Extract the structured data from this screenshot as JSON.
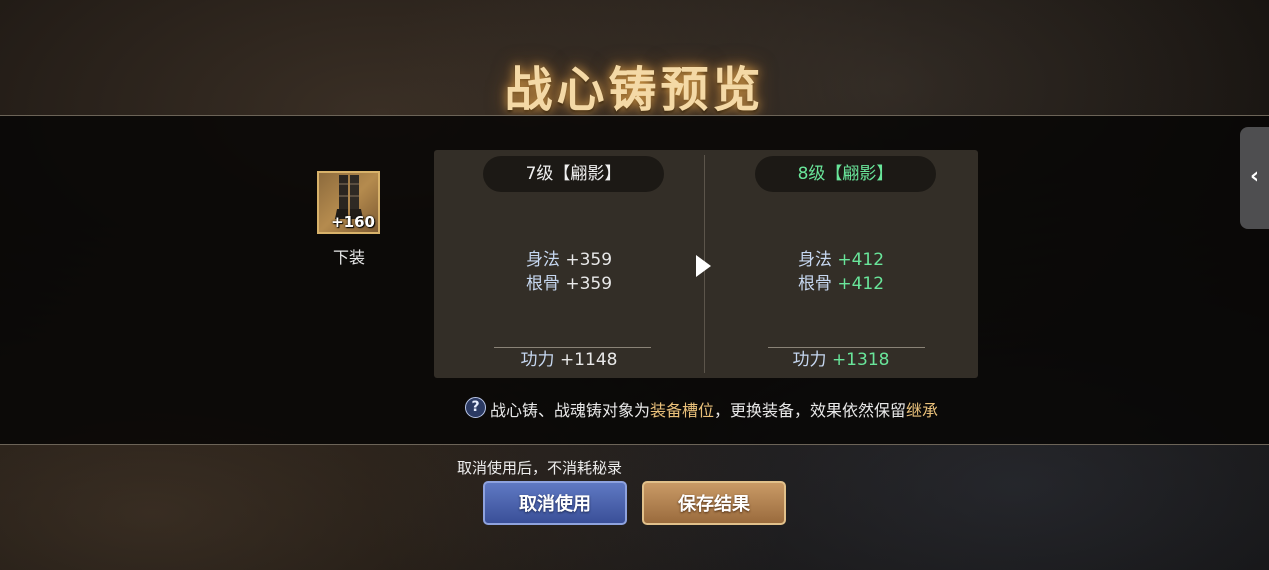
{
  "title": "战心铸预览",
  "item": {
    "level_badge": "+160",
    "name": "下装",
    "icon": "boots-icon"
  },
  "current": {
    "level_label": "7级【翩影】",
    "stats": [
      {
        "label": "身法",
        "value": "+359"
      },
      {
        "label": "根骨",
        "value": "+359"
      }
    ],
    "power_label": "功力",
    "power_value": "+1148"
  },
  "next": {
    "level_label": "8级【翩影】",
    "stats": [
      {
        "label": "身法",
        "value": "+412"
      },
      {
        "label": "根骨",
        "value": "+412"
      }
    ],
    "power_label": "功力",
    "power_value": "+1318"
  },
  "help": {
    "icon_text": "?",
    "part1": "战心铸、战魂铸对象为",
    "highlight1": "装备槽位",
    "part2": "，更换装备，效果依然保留",
    "highlight2": "继承"
  },
  "note": "取消使用后，不消耗秘录",
  "buttons": {
    "cancel_label": "取消使用",
    "save_label": "保存结果"
  },
  "side_tab": {
    "icon": "chevron-left-icon",
    "glyph": "‹"
  },
  "colors": {
    "title_glow": "#f4d9a6",
    "upgrade_green": "#69e59a",
    "highlight_gold": "#e9c07a",
    "cancel_blue": "#4a60b0",
    "save_gold": "#b88650"
  }
}
